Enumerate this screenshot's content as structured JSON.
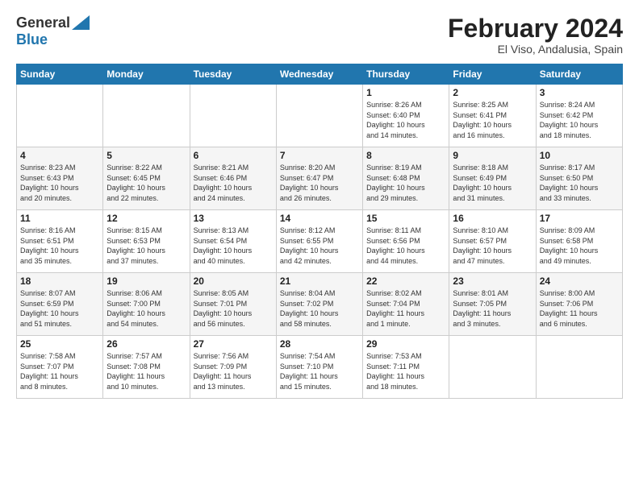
{
  "header": {
    "logo_general": "General",
    "logo_blue": "Blue",
    "month_title": "February 2024",
    "location": "El Viso, Andalusia, Spain"
  },
  "weekdays": [
    "Sunday",
    "Monday",
    "Tuesday",
    "Wednesday",
    "Thursday",
    "Friday",
    "Saturday"
  ],
  "weeks": [
    [
      {
        "day": "",
        "info": ""
      },
      {
        "day": "",
        "info": ""
      },
      {
        "day": "",
        "info": ""
      },
      {
        "day": "",
        "info": ""
      },
      {
        "day": "1",
        "info": "Sunrise: 8:26 AM\nSunset: 6:40 PM\nDaylight: 10 hours\nand 14 minutes."
      },
      {
        "day": "2",
        "info": "Sunrise: 8:25 AM\nSunset: 6:41 PM\nDaylight: 10 hours\nand 16 minutes."
      },
      {
        "day": "3",
        "info": "Sunrise: 8:24 AM\nSunset: 6:42 PM\nDaylight: 10 hours\nand 18 minutes."
      }
    ],
    [
      {
        "day": "4",
        "info": "Sunrise: 8:23 AM\nSunset: 6:43 PM\nDaylight: 10 hours\nand 20 minutes."
      },
      {
        "day": "5",
        "info": "Sunrise: 8:22 AM\nSunset: 6:45 PM\nDaylight: 10 hours\nand 22 minutes."
      },
      {
        "day": "6",
        "info": "Sunrise: 8:21 AM\nSunset: 6:46 PM\nDaylight: 10 hours\nand 24 minutes."
      },
      {
        "day": "7",
        "info": "Sunrise: 8:20 AM\nSunset: 6:47 PM\nDaylight: 10 hours\nand 26 minutes."
      },
      {
        "day": "8",
        "info": "Sunrise: 8:19 AM\nSunset: 6:48 PM\nDaylight: 10 hours\nand 29 minutes."
      },
      {
        "day": "9",
        "info": "Sunrise: 8:18 AM\nSunset: 6:49 PM\nDaylight: 10 hours\nand 31 minutes."
      },
      {
        "day": "10",
        "info": "Sunrise: 8:17 AM\nSunset: 6:50 PM\nDaylight: 10 hours\nand 33 minutes."
      }
    ],
    [
      {
        "day": "11",
        "info": "Sunrise: 8:16 AM\nSunset: 6:51 PM\nDaylight: 10 hours\nand 35 minutes."
      },
      {
        "day": "12",
        "info": "Sunrise: 8:15 AM\nSunset: 6:53 PM\nDaylight: 10 hours\nand 37 minutes."
      },
      {
        "day": "13",
        "info": "Sunrise: 8:13 AM\nSunset: 6:54 PM\nDaylight: 10 hours\nand 40 minutes."
      },
      {
        "day": "14",
        "info": "Sunrise: 8:12 AM\nSunset: 6:55 PM\nDaylight: 10 hours\nand 42 minutes."
      },
      {
        "day": "15",
        "info": "Sunrise: 8:11 AM\nSunset: 6:56 PM\nDaylight: 10 hours\nand 44 minutes."
      },
      {
        "day": "16",
        "info": "Sunrise: 8:10 AM\nSunset: 6:57 PM\nDaylight: 10 hours\nand 47 minutes."
      },
      {
        "day": "17",
        "info": "Sunrise: 8:09 AM\nSunset: 6:58 PM\nDaylight: 10 hours\nand 49 minutes."
      }
    ],
    [
      {
        "day": "18",
        "info": "Sunrise: 8:07 AM\nSunset: 6:59 PM\nDaylight: 10 hours\nand 51 minutes."
      },
      {
        "day": "19",
        "info": "Sunrise: 8:06 AM\nSunset: 7:00 PM\nDaylight: 10 hours\nand 54 minutes."
      },
      {
        "day": "20",
        "info": "Sunrise: 8:05 AM\nSunset: 7:01 PM\nDaylight: 10 hours\nand 56 minutes."
      },
      {
        "day": "21",
        "info": "Sunrise: 8:04 AM\nSunset: 7:02 PM\nDaylight: 10 hours\nand 58 minutes."
      },
      {
        "day": "22",
        "info": "Sunrise: 8:02 AM\nSunset: 7:04 PM\nDaylight: 11 hours\nand 1 minute."
      },
      {
        "day": "23",
        "info": "Sunrise: 8:01 AM\nSunset: 7:05 PM\nDaylight: 11 hours\nand 3 minutes."
      },
      {
        "day": "24",
        "info": "Sunrise: 8:00 AM\nSunset: 7:06 PM\nDaylight: 11 hours\nand 6 minutes."
      }
    ],
    [
      {
        "day": "25",
        "info": "Sunrise: 7:58 AM\nSunset: 7:07 PM\nDaylight: 11 hours\nand 8 minutes."
      },
      {
        "day": "26",
        "info": "Sunrise: 7:57 AM\nSunset: 7:08 PM\nDaylight: 11 hours\nand 10 minutes."
      },
      {
        "day": "27",
        "info": "Sunrise: 7:56 AM\nSunset: 7:09 PM\nDaylight: 11 hours\nand 13 minutes."
      },
      {
        "day": "28",
        "info": "Sunrise: 7:54 AM\nSunset: 7:10 PM\nDaylight: 11 hours\nand 15 minutes."
      },
      {
        "day": "29",
        "info": "Sunrise: 7:53 AM\nSunset: 7:11 PM\nDaylight: 11 hours\nand 18 minutes."
      },
      {
        "day": "",
        "info": ""
      },
      {
        "day": "",
        "info": ""
      }
    ]
  ]
}
